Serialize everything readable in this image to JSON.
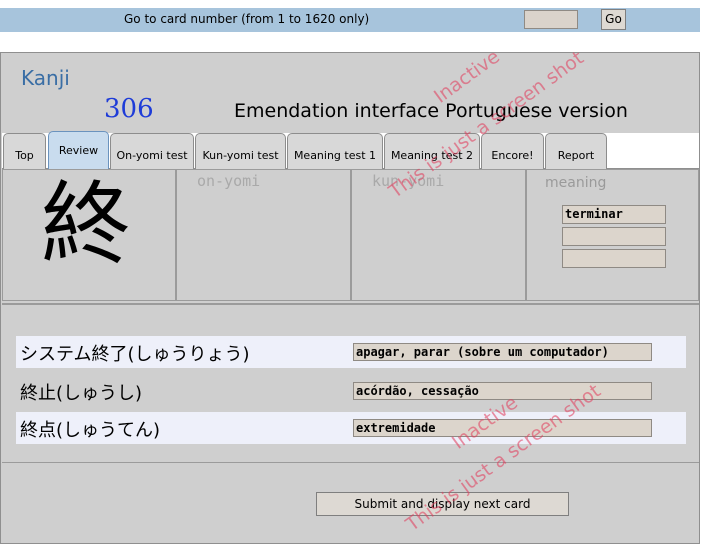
{
  "topbar": {
    "goto_label": "Go to card number (from 1 to 1620 only)",
    "goto_value": "",
    "go_label": "Go"
  },
  "header": {
    "title": "Kanji",
    "card_number": "306",
    "heading": "Emendation interface  Portuguese version"
  },
  "tabs": [
    {
      "label": "Top",
      "active": false
    },
    {
      "label": "Review",
      "active": true
    },
    {
      "label": "On-yomi test",
      "active": false
    },
    {
      "label": "Kun-yomi test",
      "active": false
    },
    {
      "label": "Meaning test 1",
      "active": false
    },
    {
      "label": "Meaning test 2",
      "active": false
    },
    {
      "label": "Encore!",
      "active": false
    },
    {
      "label": "Report",
      "active": false
    }
  ],
  "card": {
    "kanji": "終",
    "onyomi_label": "on-yomi",
    "kunyomi_label": "kun-yomi",
    "meaning_label": "meaning",
    "meanings": [
      "terminar",
      "",
      ""
    ]
  },
  "vocab": [
    {
      "word": "システム終了(しゅうりょう)",
      "meaning": "apagar, parar (sobre um computador)"
    },
    {
      "word": "終止(しゅうし)",
      "meaning": "acórdão, cessação"
    },
    {
      "word": "終点(しゅうてん)",
      "meaning": "extremidade"
    }
  ],
  "submit_label": "Submit and display next card",
  "watermark": {
    "line1": "Inactive",
    "line2": "This is just a screen shot"
  },
  "colors": {
    "topbar": "#a7c4dc",
    "panel": "#cfcfcf",
    "active_tab": "#c9dcee",
    "watermark": "#e23a5a",
    "card_number": "#1e3cd8"
  }
}
